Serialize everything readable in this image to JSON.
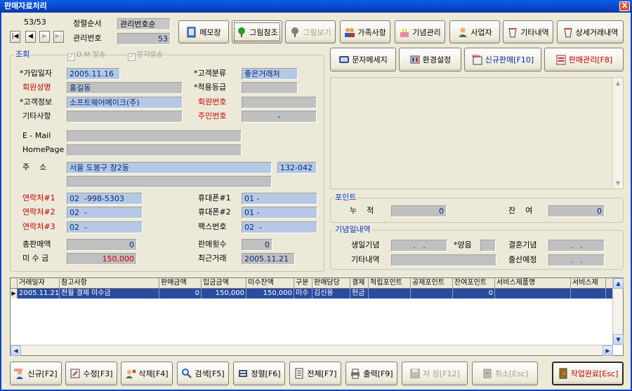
{
  "window": {
    "title": "판매자료처리",
    "close": "X"
  },
  "nav": {
    "position": "53/53",
    "first": "|◀",
    "prev": "◀",
    "next": "▶",
    "last": "▶|"
  },
  "sort": {
    "label": "정렬순서",
    "value": "관리번호순"
  },
  "mgmt": {
    "label": "관리번호",
    "value": "53"
  },
  "top_buttons": {
    "memo": "메모장",
    "image_ref": "그림참조",
    "image_view": "그림보기",
    "family": "가족사항",
    "anniv": "기념관리",
    "business": "사업자",
    "other": "기타내역",
    "detail": "상세거래내역"
  },
  "second_buttons": {
    "sms": "문자메세지",
    "env": "환경설정",
    "new_sale": "신규판매[F10]",
    "sale_mgmt": "판매관리[F8]"
  },
  "query": {
    "title": "조회",
    "dm": "D.M 발송",
    "sms_send": "문자발송"
  },
  "form": {
    "join_date": {
      "label": "*가입일자",
      "value": "2005.11.16"
    },
    "cust_type": {
      "label": "*고객분류",
      "value": "좋은거래처"
    },
    "member_name": {
      "label": "회원성명",
      "value": "홍길동"
    },
    "grade": {
      "label": "*적용등급",
      "value": ""
    },
    "cust_info": {
      "label": "*고객정보",
      "value": "소프트웨어메이크(주)"
    },
    "member_no": {
      "label": "회원번호",
      "value": ""
    },
    "other": {
      "label": "기타사항",
      "value": ""
    },
    "resident_no": {
      "label": "주민번호",
      "value": "-"
    },
    "email": {
      "label": "E - Mail",
      "value": ""
    },
    "homepage": {
      "label": "HomePage",
      "value": ""
    },
    "address": {
      "label": "주    소",
      "value": "서울 도봉구 창2동",
      "zip": "132-042",
      "line2": ""
    },
    "contact1": {
      "label": "연락처#1",
      "value": "02  -998-5303"
    },
    "mobile1": {
      "label": "휴대폰#1",
      "value": "01 -"
    },
    "contact2": {
      "label": "연락처#2",
      "value": "02  -"
    },
    "mobile2": {
      "label": "휴대폰#2",
      "value": "01 -"
    },
    "contact3": {
      "label": "연락처#3",
      "value": "02  -"
    },
    "fax": {
      "label": "팩스번호",
      "value": "02  -"
    },
    "total_sales": {
      "label": "총판매액",
      "value": "0"
    },
    "sale_count": {
      "label": "판매횟수",
      "value": "0"
    },
    "receivable": {
      "label": "미 수 금",
      "value": "150,000"
    },
    "last_trade": {
      "label": "최근거래",
      "value": "2005.11.21"
    }
  },
  "points": {
    "title": "포인트",
    "accum_label": "누    적",
    "accum_value": "0",
    "balance_label": "잔    여",
    "balance_value": "0"
  },
  "anniversary": {
    "title": "기념일내역",
    "birthday_label": "생일기념",
    "birthday_value": ".   .",
    "lunar_label": "*양음",
    "lunar_value": "",
    "wedding_label": "결혼기념",
    "wedding_value": ".   .",
    "other_label": "기타내역",
    "other_value": "",
    "birth_label": "출산예정",
    "birth_value": ".   ."
  },
  "grid": {
    "columns": [
      "거래일자",
      "참고사항",
      "판매금액",
      "입금금액",
      "미수잔액",
      "구분",
      "판매담당",
      "결제",
      "적립포인트",
      "공제포인트",
      "잔여포인트",
      "서비스제품명",
      "서비스제"
    ],
    "rows": [
      [
        "2005.11.21",
        "전월 결제 미수금",
        "0",
        "150,000",
        "150,000",
        "미수",
        "김신용",
        "현금",
        "",
        "",
        "0",
        "",
        ""
      ]
    ]
  },
  "bottom_buttons": {
    "new": "신규[F2]",
    "edit": "수정[F3]",
    "delete": "삭제[F4]",
    "search": "검색[F5]",
    "sort": "정렬[F6]",
    "all": "전체[F7]",
    "print": "출력[F9]",
    "save": "저 장[F12]",
    "cancel": "취소[Esc]",
    "done": "작업완료[Esc]"
  },
  "badges": {
    "new": "NEW"
  }
}
